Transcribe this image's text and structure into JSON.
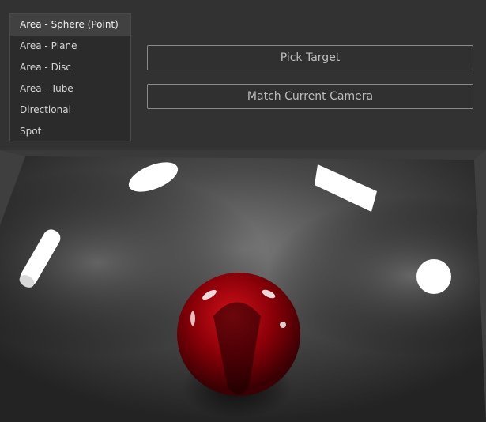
{
  "light_type_menu": {
    "items": [
      {
        "label": "Area - Sphere (Point)",
        "selected": true
      },
      {
        "label": "Area - Plane",
        "selected": false
      },
      {
        "label": "Area - Disc",
        "selected": false
      },
      {
        "label": "Area - Tube",
        "selected": false
      },
      {
        "label": "Directional",
        "selected": false
      },
      {
        "label": "Spot",
        "selected": false
      }
    ]
  },
  "buttons": {
    "pick_target": "Pick Target",
    "match_camera": "Match Current Camera"
  },
  "colors": {
    "panel_bg": "#323232",
    "button_border": "#8a8a8a",
    "sphere_red": "#b0000a",
    "light_white": "#ffffff"
  }
}
